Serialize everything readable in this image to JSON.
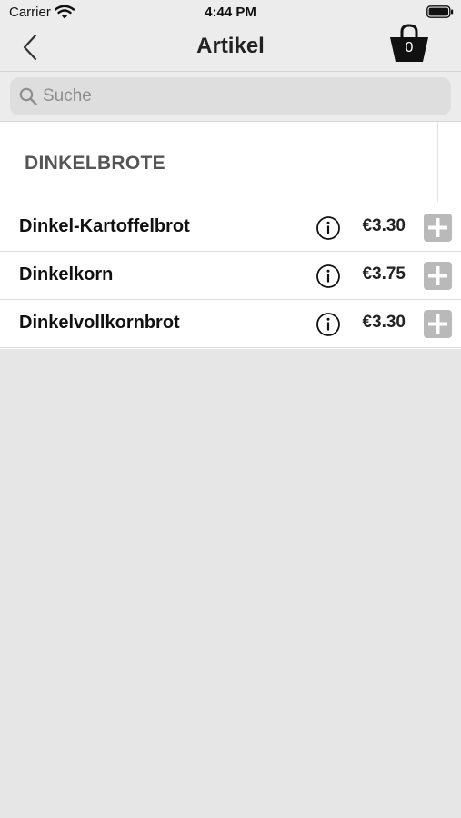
{
  "status_bar": {
    "carrier": "Carrier",
    "time": "4:44 PM"
  },
  "nav": {
    "title": "Artikel",
    "cart_count": "0"
  },
  "search": {
    "placeholder": "Suche"
  },
  "section": {
    "header": "DINKELBROTE"
  },
  "items": [
    {
      "name": "Dinkel-Kartoffelbrot",
      "price": "€3.30"
    },
    {
      "name": "Dinkelkorn",
      "price": "€3.75"
    },
    {
      "name": "Dinkelvollkornbrot",
      "price": "€3.30"
    }
  ],
  "colors": {
    "nav_background": "#ececec",
    "page_background": "#e6e6e6",
    "add_button": "#b9b9b9"
  }
}
